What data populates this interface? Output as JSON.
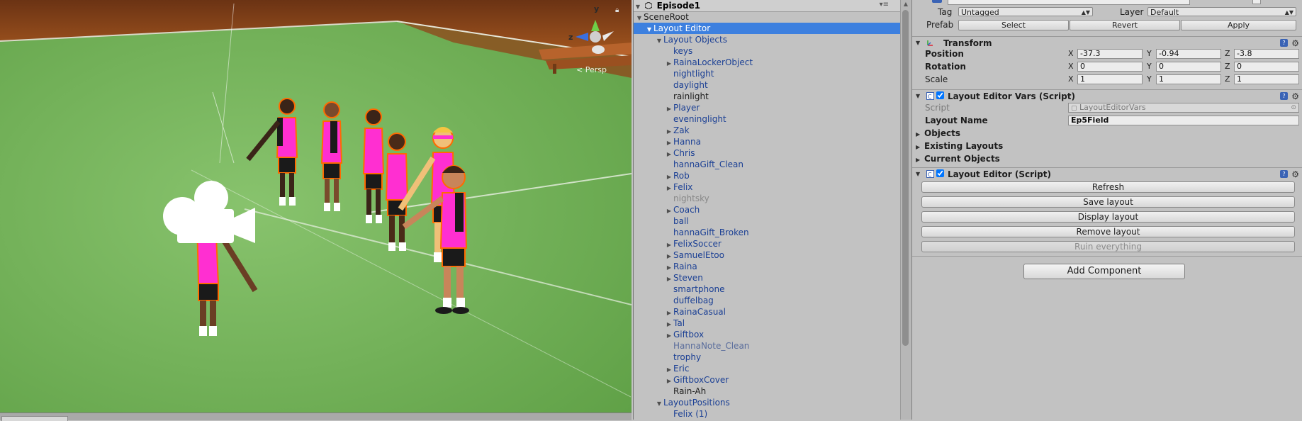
{
  "scene": {
    "persp_label": "Persp",
    "gizmo_axes": [
      "y",
      "z"
    ]
  },
  "hierarchy": {
    "scene_name": "Episode1",
    "items": [
      {
        "label": "SceneRoot",
        "depth": 1,
        "arrow": "down",
        "style": "normal"
      },
      {
        "label": "Layout Editor",
        "depth": 2,
        "arrow": "down",
        "style": "selected"
      },
      {
        "label": "Layout Objects",
        "depth": 3,
        "arrow": "down",
        "style": "prefab"
      },
      {
        "label": "keys",
        "depth": 4,
        "arrow": "",
        "style": "prefab"
      },
      {
        "label": "RainaLockerObject",
        "depth": 4,
        "arrow": "right",
        "style": "prefab"
      },
      {
        "label": "nightlight",
        "depth": 4,
        "arrow": "",
        "style": "prefab"
      },
      {
        "label": "daylight",
        "depth": 4,
        "arrow": "",
        "style": "prefab"
      },
      {
        "label": "rainlight",
        "depth": 4,
        "arrow": "",
        "style": "normal"
      },
      {
        "label": "Player",
        "depth": 4,
        "arrow": "right",
        "style": "prefab"
      },
      {
        "label": "eveninglight",
        "depth": 4,
        "arrow": "",
        "style": "prefab"
      },
      {
        "label": "Zak",
        "depth": 4,
        "arrow": "right",
        "style": "prefab"
      },
      {
        "label": "Hanna",
        "depth": 4,
        "arrow": "right",
        "style": "prefab"
      },
      {
        "label": "Chris",
        "depth": 4,
        "arrow": "right",
        "style": "prefab"
      },
      {
        "label": "hannaGift_Clean",
        "depth": 4,
        "arrow": "",
        "style": "prefab"
      },
      {
        "label": "Rob",
        "depth": 4,
        "arrow": "right",
        "style": "prefab"
      },
      {
        "label": "Felix",
        "depth": 4,
        "arrow": "right",
        "style": "prefab"
      },
      {
        "label": "nightsky",
        "depth": 4,
        "arrow": "",
        "style": "inactive"
      },
      {
        "label": "Coach",
        "depth": 4,
        "arrow": "right",
        "style": "prefab"
      },
      {
        "label": "ball",
        "depth": 4,
        "arrow": "",
        "style": "prefab"
      },
      {
        "label": "hannaGift_Broken",
        "depth": 4,
        "arrow": "",
        "style": "prefab"
      },
      {
        "label": "FelixSoccer",
        "depth": 4,
        "arrow": "right",
        "style": "prefab"
      },
      {
        "label": "SamuelEtoo",
        "depth": 4,
        "arrow": "right",
        "style": "prefab"
      },
      {
        "label": "Raina",
        "depth": 4,
        "arrow": "right",
        "style": "prefab"
      },
      {
        "label": "Steven",
        "depth": 4,
        "arrow": "right",
        "style": "prefab"
      },
      {
        "label": "smartphone",
        "depth": 4,
        "arrow": "",
        "style": "prefab"
      },
      {
        "label": "duffelbag",
        "depth": 4,
        "arrow": "",
        "style": "prefab"
      },
      {
        "label": "RainaCasual",
        "depth": 4,
        "arrow": "right",
        "style": "prefab"
      },
      {
        "label": "Tal",
        "depth": 4,
        "arrow": "right",
        "style": "prefab"
      },
      {
        "label": "Giftbox",
        "depth": 4,
        "arrow": "right",
        "style": "prefab"
      },
      {
        "label": "HannaNote_Clean",
        "depth": 4,
        "arrow": "",
        "style": "prefab-broken"
      },
      {
        "label": "trophy",
        "depth": 4,
        "arrow": "",
        "style": "prefab"
      },
      {
        "label": "Eric",
        "depth": 4,
        "arrow": "right",
        "style": "prefab"
      },
      {
        "label": "GiftboxCover",
        "depth": 4,
        "arrow": "right",
        "style": "prefab"
      },
      {
        "label": "Rain-Ah",
        "depth": 4,
        "arrow": "",
        "style": "normal"
      },
      {
        "label": "LayoutPositions",
        "depth": 3,
        "arrow": "down",
        "style": "prefab"
      },
      {
        "label": "Felix (1)",
        "depth": 4,
        "arrow": "",
        "style": "prefab"
      }
    ]
  },
  "inspector": {
    "tag_label": "Tag",
    "tag_value": "Untagged",
    "layer_label": "Layer",
    "layer_value": "Default",
    "prefab_label": "Prefab",
    "prefab_select": "Select",
    "prefab_revert": "Revert",
    "prefab_apply": "Apply",
    "transform": {
      "title": "Transform",
      "position_label": "Position",
      "rotation_label": "Rotation",
      "scale_label": "Scale",
      "position": {
        "x": "-37.3",
        "y": "-0.94",
        "z": "-3.8"
      },
      "rotation": {
        "x": "0",
        "y": "0",
        "z": "0"
      },
      "scale": {
        "x": "1",
        "y": "1",
        "z": "1"
      }
    },
    "vars": {
      "title": "Layout Editor Vars (Script)",
      "script_label": "Script",
      "script_value": "LayoutEditorVars",
      "layout_name_label": "Layout Name",
      "layout_name_value": "Ep5Field",
      "objects_label": "Objects",
      "existing_label": "Existing Layouts",
      "current_label": "Current Objects"
    },
    "editor": {
      "title": "Layout Editor (Script)",
      "refresh": "Refresh",
      "save": "Save layout",
      "display": "Display layout",
      "remove": "Remove layout",
      "ruin": "Ruin everything"
    },
    "add_component": "Add Component",
    "axis_x": "X",
    "axis_y": "Y",
    "axis_z": "Z"
  }
}
